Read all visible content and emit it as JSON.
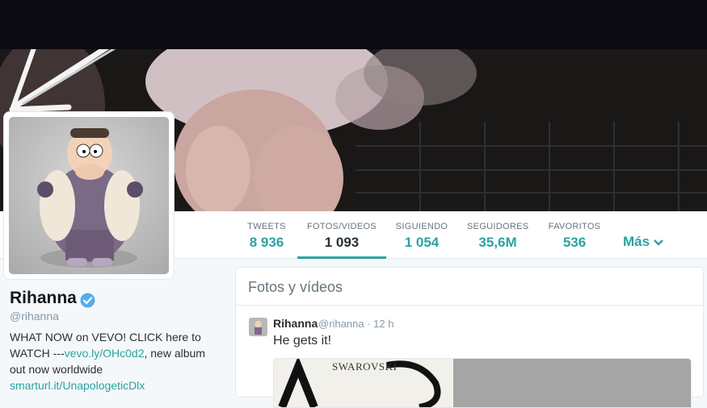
{
  "colors": {
    "accent": "#2aa3a1",
    "link": "#2b7bb9",
    "topbar": "#0b0a12"
  },
  "nav": {
    "tabs": [
      {
        "label": "TWEETS",
        "value": "8 936"
      },
      {
        "label": "FOTOS/VIDEOS",
        "value": "1 093"
      },
      {
        "label": "SIGUIENDO",
        "value": "1 054"
      },
      {
        "label": "SEGUIDORES",
        "value": "35,6M"
      },
      {
        "label": "FAVORITOS",
        "value": "536"
      }
    ],
    "active_tab": "FOTOS/VIDEOS",
    "more_label": "Más"
  },
  "profile": {
    "name": "Rihanna",
    "handle": "@rihanna",
    "verified": true,
    "bio_text_1": "WHAT NOW on VEVO! CLICK here to WATCH ---",
    "bio_link_1": "vevo.ly/OHc0d2",
    "bio_text_2": ", new album out now worldwide",
    "bio_link_2": "smarturl.it/UnapologeticDlx"
  },
  "media_panel": {
    "title": "Fotos y vídeos",
    "tweet": {
      "name": "Rihanna",
      "handle_time": "@rihanna · 12 h",
      "text": "He gets it!",
      "image_text": "SWAROVSKI"
    }
  },
  "icons": [
    "verified-badge-icon",
    "chevron-down-icon",
    "hand-drawn-arrow-icon"
  ]
}
